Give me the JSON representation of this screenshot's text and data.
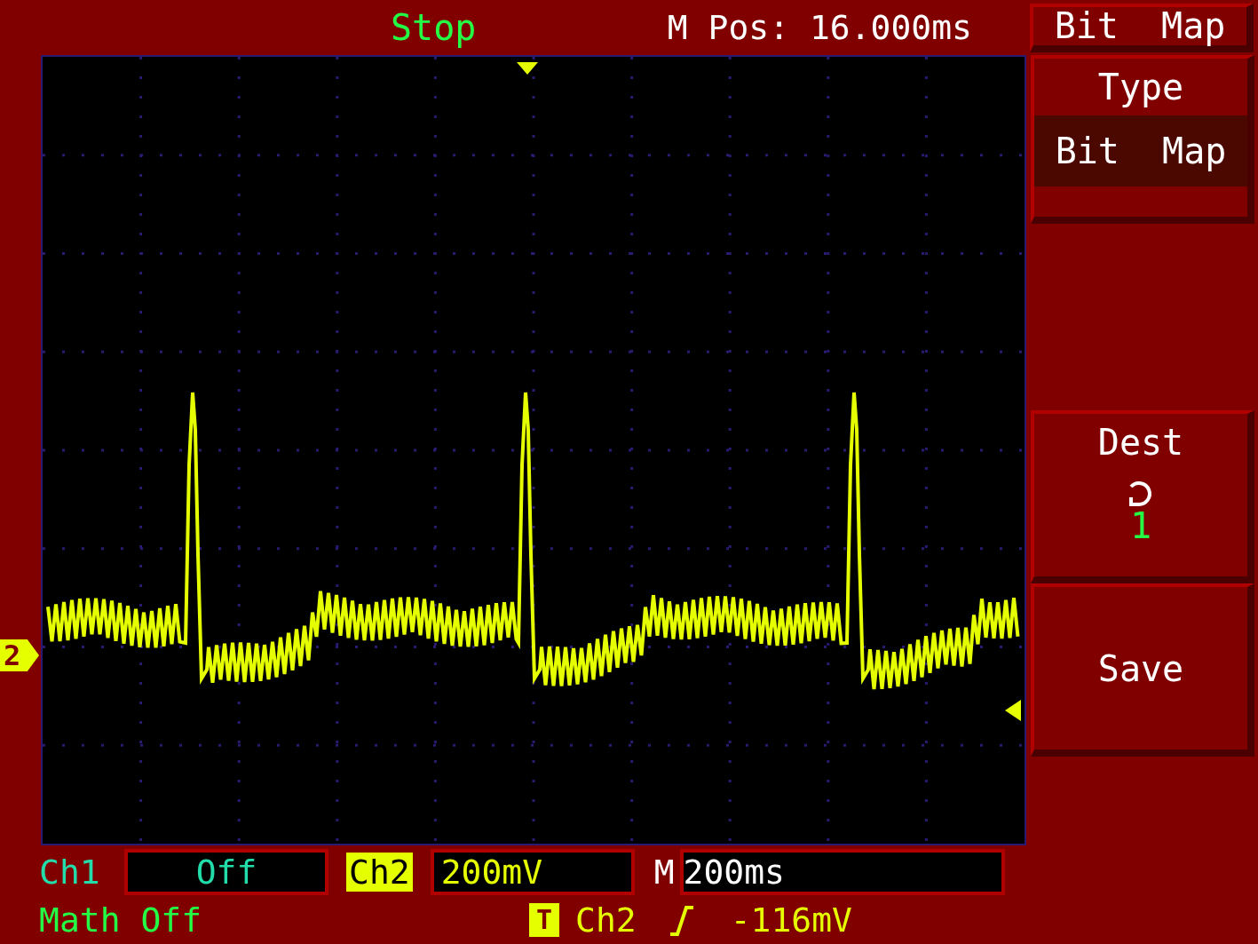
{
  "status": "Stop",
  "m_pos": "M Pos: 16.000ms",
  "menu_title": "Bit  Map",
  "channel_marker": "2",
  "menu": [
    {
      "kind": "option",
      "label": "Type",
      "value": "Bit  Map"
    },
    {
      "kind": "dest",
      "label": "Dest",
      "value": "1"
    },
    {
      "kind": "action",
      "label": "Save"
    }
  ],
  "channels": [
    {
      "label": "Ch1",
      "value": "Off",
      "selected": false
    },
    {
      "label": "Ch2",
      "value": "200mV",
      "selected": true
    }
  ],
  "timebase": {
    "label": "M",
    "value": "200ms"
  },
  "math": "Math Off",
  "trigger": {
    "badge": "T",
    "source": "Ch2",
    "level": "-116mV"
  }
}
